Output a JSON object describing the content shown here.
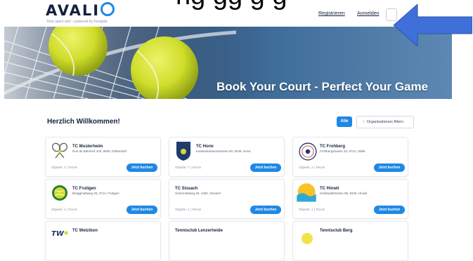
{
  "header": {
    "logo_text": "AVALI",
    "logo_tail": "",
    "tagline": "Time spent well – powered by Feelgate",
    "overlay_text": "ng gg g g",
    "register": "Registrieren",
    "login": "Anmelden"
  },
  "hero": {
    "title": "Book Your Court - Perfect Your Game"
  },
  "main": {
    "welcome": "Herzlich Willkommen!",
    "all_button": "Alle",
    "filter_button": "Organisationen filtern",
    "clubs": [
      {
        "name": "TC Musterheim",
        "address": "Rue de Bahnhof 100, 8600, Dübendorf",
        "meta": "Objekte: 3 | Tennis",
        "button": "Jetzt buchen",
        "logo": "crossed-rackets-icon"
      },
      {
        "name": "TC Horw",
        "address": "Kastanienbaumstrasse 90, 6048, Horw",
        "meta": "Objekte: 7 | Tennis",
        "button": "Jetzt buchen",
        "logo": "shield-crest-icon"
      },
      {
        "name": "TC Frohberg",
        "address": "Frohbergstrasse 33, 8712, Stäfa",
        "meta": "Objekte: 2 | Tennis",
        "button": "Jetzt buchen",
        "logo": "round-seal-icon"
      },
      {
        "name": "TC Frutigen",
        "address": "Brüggmattweg 25, 3714, Frutigen",
        "meta": "Objekte: 4 | Tennis",
        "button": "Jetzt buchen",
        "logo": "tennis-ball-emblem-icon"
      },
      {
        "name": "TC Sissach",
        "address": "Grienmattweg 49, 4450, Sissach",
        "meta": "Objekte: 1 | Tennis",
        "button": "Jetzt buchen",
        "logo": ""
      },
      {
        "name": "TC Hinwil",
        "address": "Hüsliwaldstrasse 95, 8340, Hinwil",
        "meta": "Objekte: 1 | Tennis",
        "button": "Jetzt buchen",
        "logo": "sun-wave-icon"
      },
      {
        "name": "TC Wetzikon",
        "address": "",
        "meta": "",
        "button": "",
        "logo": "tcw-logo-icon"
      },
      {
        "name": "Tennisclub Lenzerheide",
        "address": "",
        "meta": "",
        "button": "",
        "logo": ""
      },
      {
        "name": "Tennisclub Berg",
        "address": "",
        "meta": "",
        "button": "",
        "logo": "sun-logo-icon"
      }
    ]
  },
  "colors": {
    "accent": "#1e88e5",
    "brand": "#14213d",
    "arrow": "#3f6fd8",
    "ball": "#d7e532"
  }
}
